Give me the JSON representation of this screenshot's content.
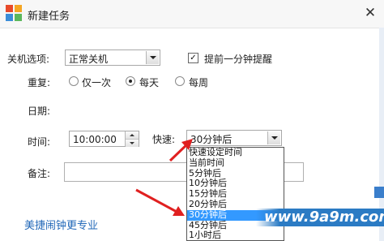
{
  "window": {
    "title": "新建任务",
    "close_glyph": "✕"
  },
  "form": {
    "shutdown_label": "关机选项:",
    "shutdown_value": "正常关机",
    "remind_checked": true,
    "remind_label": "提前一分钟提醒",
    "repeat_label": "重复:",
    "repeat_options": [
      "仅一次",
      "每天",
      "每周"
    ],
    "repeat_selected": "每天",
    "date_label": "日期:",
    "time_label": "时间:",
    "time_value": "10:00:00",
    "quick_label": "快速:",
    "quick_value": "30分钟后",
    "note_label": "备注:",
    "note_value": ""
  },
  "dropdown": {
    "options": [
      "快速设定时间",
      "当前时间",
      "5分钟后",
      "10分钟后",
      "15分钟后",
      "20分钟后",
      "30分钟后",
      "45分钟后",
      "1小时后"
    ],
    "selected": "30分钟后"
  },
  "promo_link": "美捷闹钟更专业",
  "watermark": "www.9a9m.com",
  "colors": {
    "accent": "#3399ff",
    "arrow": "#e02020",
    "link": "#2268b8"
  }
}
